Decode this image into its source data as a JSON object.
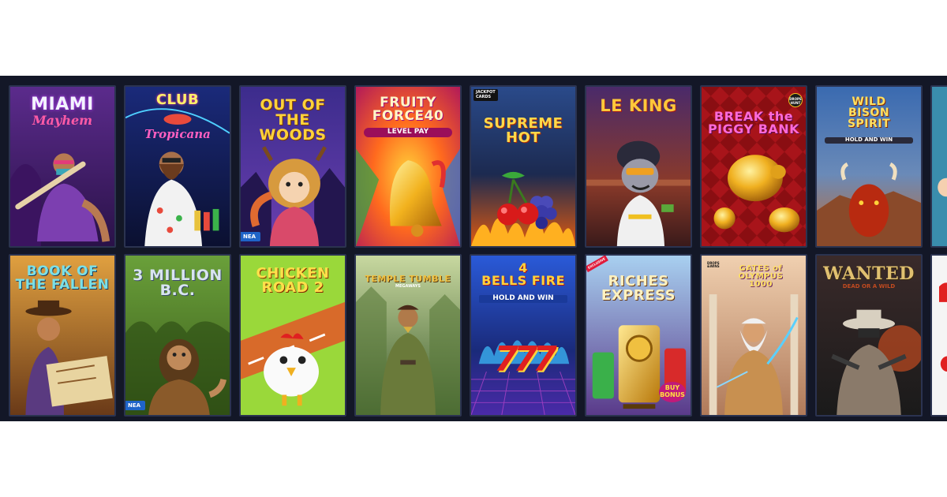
{
  "row1": [
    {
      "title": "MIAMI",
      "subtitle": "Mayhem"
    },
    {
      "title": "CLUB",
      "subtitle": "Tropicana"
    },
    {
      "title": "OUT OF THE\nWOODS",
      "badge": "NEA"
    },
    {
      "title": "FRUITY\nFORCE40",
      "subtitle": "LEVEL PAY"
    },
    {
      "title": "SUPREME\nHOT",
      "tag": "JACKPOT\nCARDS"
    },
    {
      "title": "LE KING"
    },
    {
      "title": "BREAK the\nPIGGY BANK",
      "tag": "DROPS\nHUNT"
    },
    {
      "title": "WILD\nBISON\nSPIRIT",
      "subtitle": "HOLD AND WIN"
    }
  ],
  "row2": [
    {
      "title": "BOOK OF\nTHE FALLEN"
    },
    {
      "title": "3 MILLION\nB.C.",
      "badge": "NEA"
    },
    {
      "title": "CHICKEN\nROAD 2"
    },
    {
      "title": "TEMPLE TUMBLE",
      "subtitle": "MEGAWAYS"
    },
    {
      "title": "4\nBELLS FIRE",
      "subtitle": "HOLD AND WIN",
      "symbol": "777"
    },
    {
      "title": "RICHES\nEXPRESS",
      "tag": "EXCLUSIVE",
      "subtitle": "BUY\nBONUS"
    },
    {
      "title": "GATES of OLYMPUS\n1000",
      "tag": "DROPS\n&WINS"
    },
    {
      "title": "WANTED",
      "subtitle": "DEAD OR A WILD"
    }
  ]
}
